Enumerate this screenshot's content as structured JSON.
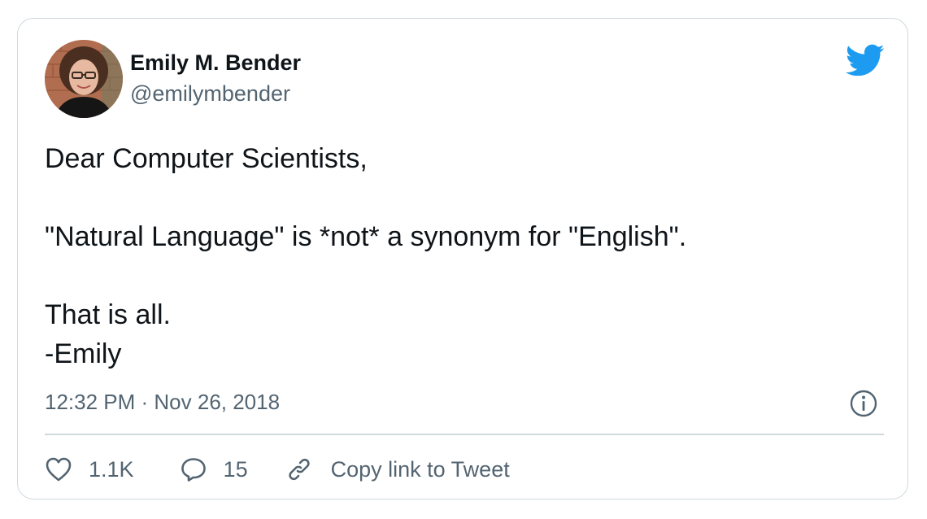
{
  "author": {
    "display_name": "Emily M. Bender",
    "handle": "@emilymbender"
  },
  "tweet": {
    "lines": [
      "Dear Computer Scientists,",
      "",
      "\"Natural Language\" is *not* a synonym for \"English\".",
      "",
      "That is all.",
      "-Emily"
    ],
    "timestamp": "12:32 PM · Nov 26, 2018"
  },
  "actions": {
    "like_count": "1.1K",
    "reply_count": "15",
    "copy_link_label": "Copy link to Tweet"
  },
  "icons": {
    "brand": "twitter-bird-icon",
    "info": "info-icon",
    "like": "heart-icon",
    "reply": "speech-bubble-icon",
    "copy": "link-icon"
  },
  "colors": {
    "brand_blue": "#1d9bf0",
    "text_primary": "#0f1419",
    "text_secondary": "#536471",
    "border": "#cfd9de"
  }
}
